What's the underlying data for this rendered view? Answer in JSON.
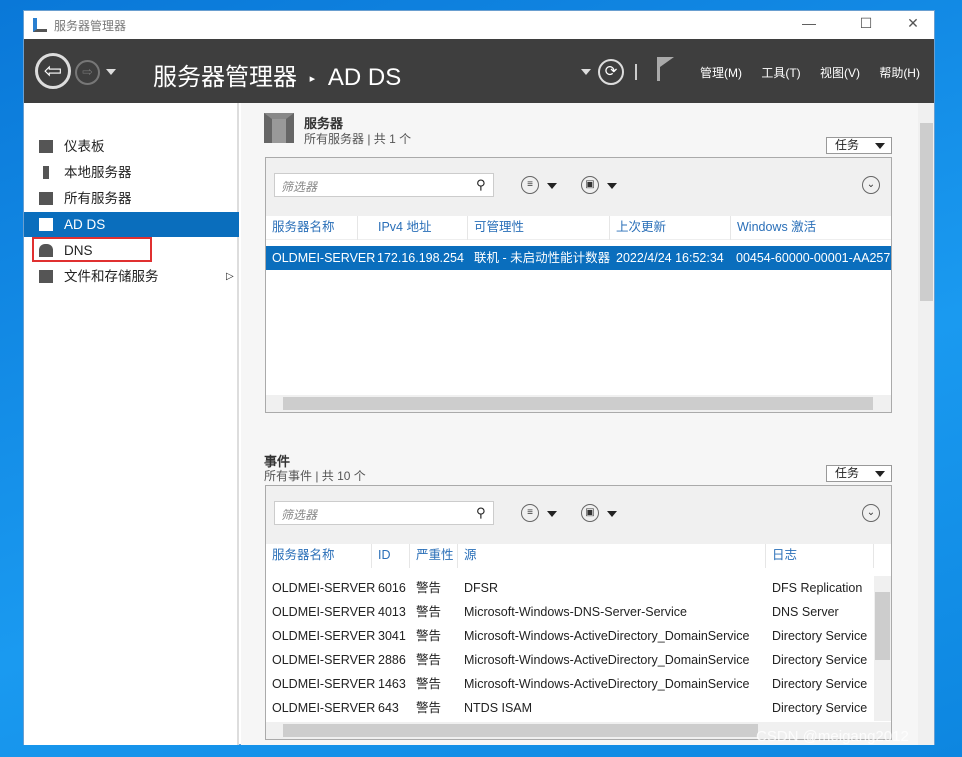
{
  "window": {
    "title": "服务器管理器",
    "controls": [
      "—",
      "☐",
      "✕"
    ]
  },
  "header": {
    "breadcrumb_root": "服务器管理器",
    "breadcrumb_sep": "▸",
    "breadcrumb_current": "AD DS",
    "menus": [
      "管理(M)",
      "工具(T)",
      "视图(V)",
      "帮助(H)"
    ]
  },
  "sidebar": {
    "items": [
      {
        "label": "仪表板",
        "icon": "dashboard-icon"
      },
      {
        "label": "本地服务器",
        "icon": "server-icon"
      },
      {
        "label": "所有服务器",
        "icon": "servers-icon"
      },
      {
        "label": "AD DS",
        "icon": "adds-icon",
        "selected": true
      },
      {
        "label": "DNS",
        "icon": "dns-icon",
        "highlighted": true
      },
      {
        "label": "文件和存储服务",
        "icon": "storage-icon",
        "expandable": true
      }
    ]
  },
  "servers": {
    "title": "服务器",
    "subtitle": "所有服务器 | 共 1 个",
    "tasks": "任务",
    "filter_placeholder": "筛选器",
    "columns": [
      "服务器名称",
      "IPv4 地址",
      "可管理性",
      "上次更新",
      "Windows 激活"
    ],
    "rows": [
      [
        "OLDMEI-SERVER",
        "172.16.198.254",
        "联机 - 未启动性能计数器",
        "2022/4/24 16:52:34",
        "00454-60000-00001-AA257"
      ]
    ]
  },
  "events": {
    "title": "事件",
    "subtitle": "所有事件 | 共 10 个",
    "tasks": "任务",
    "filter_placeholder": "筛选器",
    "columns": [
      "服务器名称",
      "ID",
      "严重性",
      "源",
      "日志"
    ],
    "rows": [
      [
        "OLDMEI-SERVER",
        "6016",
        "警告",
        "DFSR",
        "DFS Replication"
      ],
      [
        "OLDMEI-SERVER",
        "4013",
        "警告",
        "Microsoft-Windows-DNS-Server-Service",
        "DNS Server"
      ],
      [
        "OLDMEI-SERVER",
        "3041",
        "警告",
        "Microsoft-Windows-ActiveDirectory_DomainService",
        "Directory Service"
      ],
      [
        "OLDMEI-SERVER",
        "2886",
        "警告",
        "Microsoft-Windows-ActiveDirectory_DomainService",
        "Directory Service"
      ],
      [
        "OLDMEI-SERVER",
        "1463",
        "警告",
        "Microsoft-Windows-ActiveDirectory_DomainService",
        "Directory Service"
      ],
      [
        "OLDMEI-SERVER",
        "643",
        "警告",
        "NTDS ISAM",
        "Directory Service"
      ]
    ]
  },
  "watermark": "CSDN @meigang2012"
}
